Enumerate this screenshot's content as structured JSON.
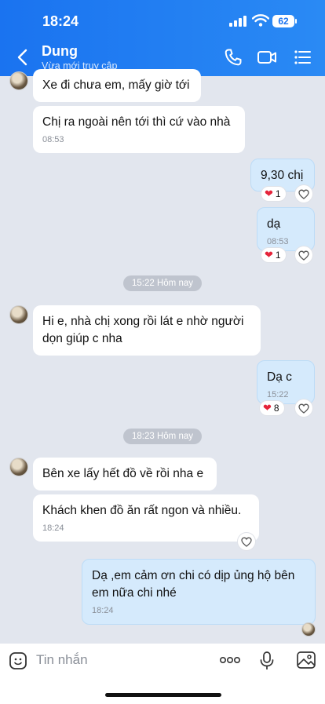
{
  "status_bar": {
    "time": "18:24",
    "battery": "62"
  },
  "header": {
    "contact_name": "Dung",
    "contact_status": "Vừa mới truy cập"
  },
  "messages": [
    {
      "text": "Xe đi chưa em, mấy giờ tới"
    },
    {
      "text": "Chị ra ngoài nên tới thì cứ vào nhà",
      "time": "08:53"
    },
    {
      "text": "9,30 chị",
      "reaction_count": "1"
    },
    {
      "text": "dạ",
      "time": "08:53",
      "reaction_count": "1"
    },
    {
      "text": "Hi e, nhà chị xong rồi lát e nhờ người dọn giúp c nha"
    },
    {
      "text": "Dạ c",
      "time": "15:22",
      "reaction_count": "8"
    },
    {
      "text": "Bên xe lấy hết đồ về rồi nha e"
    },
    {
      "text": "Khách khen đồ ăn rất ngon và nhiều.",
      "time": "18:24"
    },
    {
      "text": "Dạ ,em cảm ơn chi có dịp ủng hộ bên em nữa chi nhé",
      "time": "18:24"
    }
  ],
  "separators": [
    "15:22 Hôm nay",
    "18:23 Hôm nay"
  ],
  "input": {
    "placeholder": "Tin nhắn"
  },
  "colors": {
    "header": "#1a73f0",
    "my_bubble": "#d5eafc",
    "background": "#e2e6ee",
    "heart": "#e5243a"
  }
}
